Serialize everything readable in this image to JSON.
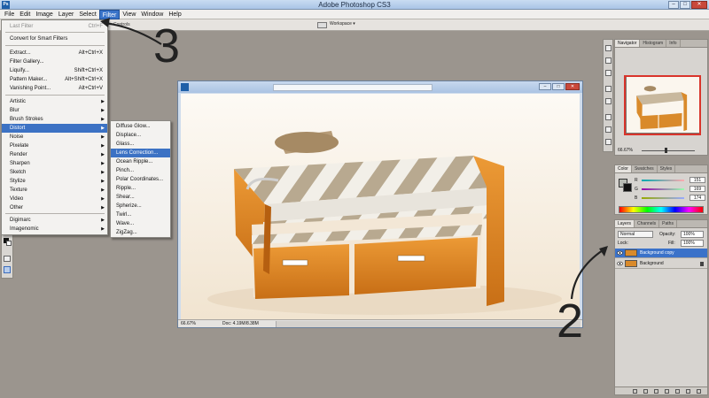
{
  "window": {
    "title": "Adobe Photoshop CS3",
    "logo": "Ps"
  },
  "menubar": [
    "File",
    "Edit",
    "Image",
    "Layer",
    "Select",
    "Filter",
    "View",
    "Window",
    "Help"
  ],
  "options_bar": {
    "controls_label": "Controls",
    "workspace_label": "Workspace ▾"
  },
  "filter_menu": {
    "items": [
      {
        "label": "Last Filter",
        "shortcut": "Ctrl+F",
        "disabled": true
      },
      {
        "label": "Convert for Smart Filters"
      },
      {
        "label": "Extract...",
        "shortcut": "Alt+Ctrl+X"
      },
      {
        "label": "Filter Gallery..."
      },
      {
        "label": "Liquify...",
        "shortcut": "Shift+Ctrl+X"
      },
      {
        "label": "Pattern Maker...",
        "shortcut": "Alt+Shift+Ctrl+X"
      },
      {
        "label": "Vanishing Point...",
        "shortcut": "Alt+Ctrl+V"
      },
      {
        "label": "Artistic",
        "submenu": true
      },
      {
        "label": "Blur",
        "submenu": true
      },
      {
        "label": "Brush Strokes",
        "submenu": true
      },
      {
        "label": "Distort",
        "submenu": true,
        "highlighted": true
      },
      {
        "label": "Noise",
        "submenu": true
      },
      {
        "label": "Pixelate",
        "submenu": true
      },
      {
        "label": "Render",
        "submenu": true
      },
      {
        "label": "Sharpen",
        "submenu": true
      },
      {
        "label": "Sketch",
        "submenu": true
      },
      {
        "label": "Stylize",
        "submenu": true
      },
      {
        "label": "Texture",
        "submenu": true
      },
      {
        "label": "Video",
        "submenu": true
      },
      {
        "label": "Other",
        "submenu": true
      },
      {
        "label": "Digimarc",
        "submenu": true
      },
      {
        "label": "Imagenomic",
        "submenu": true
      }
    ]
  },
  "distort_submenu": {
    "items": [
      "Diffuse Glow...",
      "Displace...",
      "Glass...",
      "Lens Correction...",
      "Ocean Ripple...",
      "Pinch...",
      "Polar Coordinates...",
      "Ripple...",
      "Shear...",
      "Spherize...",
      "Twirl...",
      "Wave...",
      "ZigZag..."
    ],
    "highlighted_index": 3
  },
  "annotations": {
    "step_a": "3",
    "step_b": "2"
  },
  "document": {
    "zoom": "66.67%",
    "info": "Doc: 4.19M/8.38M"
  },
  "navigator": {
    "tabs": [
      "Navigator",
      "Histogram",
      "Info"
    ],
    "zoom": "66.67%"
  },
  "color_panel": {
    "tabs": [
      "Color",
      "Swatches",
      "Styles"
    ],
    "channels": [
      {
        "letter": "R",
        "value": "151"
      },
      {
        "letter": "G",
        "value": "169"
      },
      {
        "letter": "B",
        "value": "174"
      }
    ]
  },
  "layers_panel": {
    "tabs": [
      "Layers",
      "Channels",
      "Paths"
    ],
    "blend_mode": "Normal",
    "opacity_label": "Opacity:",
    "opacity": "100%",
    "lock_label": "Lock:",
    "fill_label": "Fill:",
    "fill": "100%",
    "layers": [
      {
        "name": "Background copy",
        "selected": true
      },
      {
        "name": "Background",
        "selected": false,
        "locked": true
      }
    ]
  },
  "colors": {
    "accent": "#3c72c4",
    "bed_orange": "#d98a2b",
    "stripe_tan": "#b3a58d"
  }
}
